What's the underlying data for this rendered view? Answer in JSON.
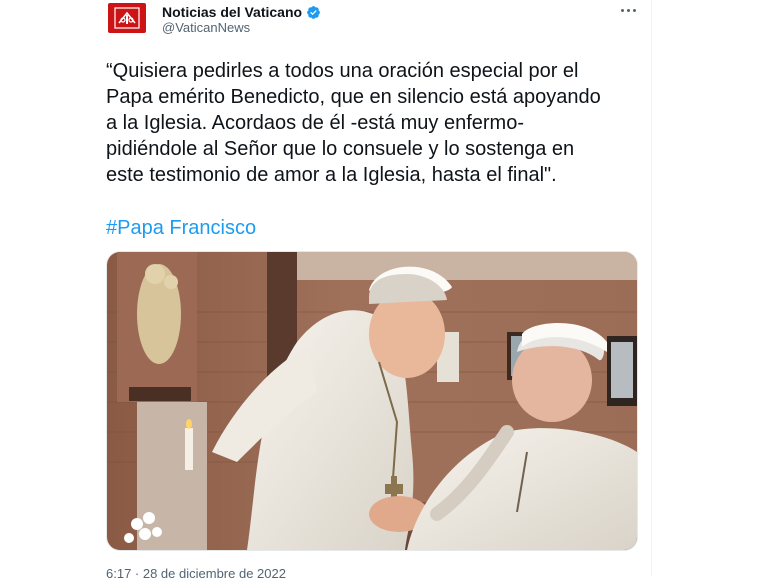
{
  "tweet": {
    "display_name": "Noticias del Vaticano",
    "handle": "@VaticanNews",
    "verified": true,
    "text": "“Quisiera pedirles a todos una oración especial por el\nPapa emérito Benedicto, que en silencio está apoyando\na la Iglesia. Acordaos de él -está muy enfermo-\npidiéndole al Señor que lo consuele y lo sostenga en\neste testimonio de amor a la Iglesia, hasta el final\".",
    "hashtag": "#Papa Francisco",
    "timestamp": "6:17 · 28 de diciembre de 2022"
  },
  "photo": {
    "subject": "Pope Francis bowing to greet Pope Emeritus Benedict XVI, holding hands"
  },
  "icons": {
    "avatar": "vatican-news-logo-icon",
    "verified": "verified-badge-icon",
    "more": "more-options-icon"
  },
  "colors": {
    "brand_red": "#cc1417",
    "link_blue": "#1d9bf0",
    "text_primary": "#0f1419",
    "text_secondary": "#536471"
  }
}
